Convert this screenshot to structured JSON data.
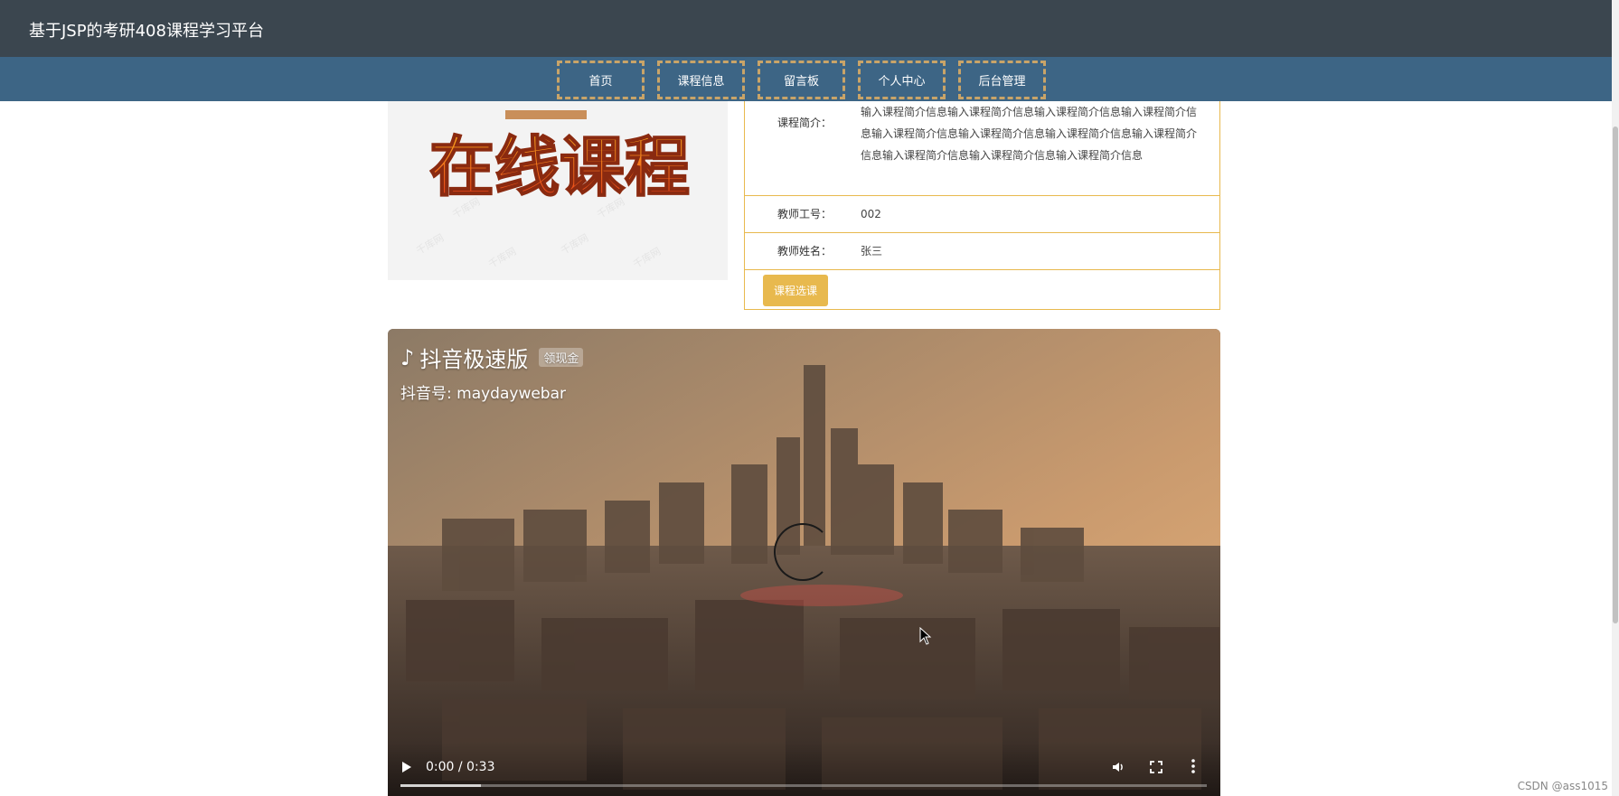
{
  "header": {
    "title": "基于JSP的考研408课程学习平台"
  },
  "nav": {
    "items": [
      {
        "label": "首页"
      },
      {
        "label": "课程信息"
      },
      {
        "label": "留言板"
      },
      {
        "label": "个人中心"
      },
      {
        "label": "后台管理"
      }
    ]
  },
  "course": {
    "banner_text": "在线课程",
    "watermark_text": "千库网",
    "intro_label": "课程简介：",
    "intro_value": "输入课程简介信息输入课程简介信息输入课程简介信息输入课程简介信息输入课程简介信息输入课程简介信息输入课程简介信息输入课程简介信息输入课程简介信息输入课程简介信息输入课程简介信息",
    "teacher_id_label": "教师工号：",
    "teacher_id_value": "002",
    "teacher_name_label": "教师姓名：",
    "teacher_name_value": "张三",
    "select_button": "课程选课"
  },
  "video": {
    "app_name": "抖音极速版",
    "badge": "领现金",
    "account": "抖音号: maydaywebar",
    "time": "0:00 / 0:33",
    "progress_fraction": 0.1
  },
  "footer": {
    "watermark": "CSDN @ass1015"
  },
  "colors": {
    "topbar": "#3b464f",
    "navbar": "#3d6585",
    "accent": "#e8b94e",
    "nav_border": "#c9a468"
  }
}
